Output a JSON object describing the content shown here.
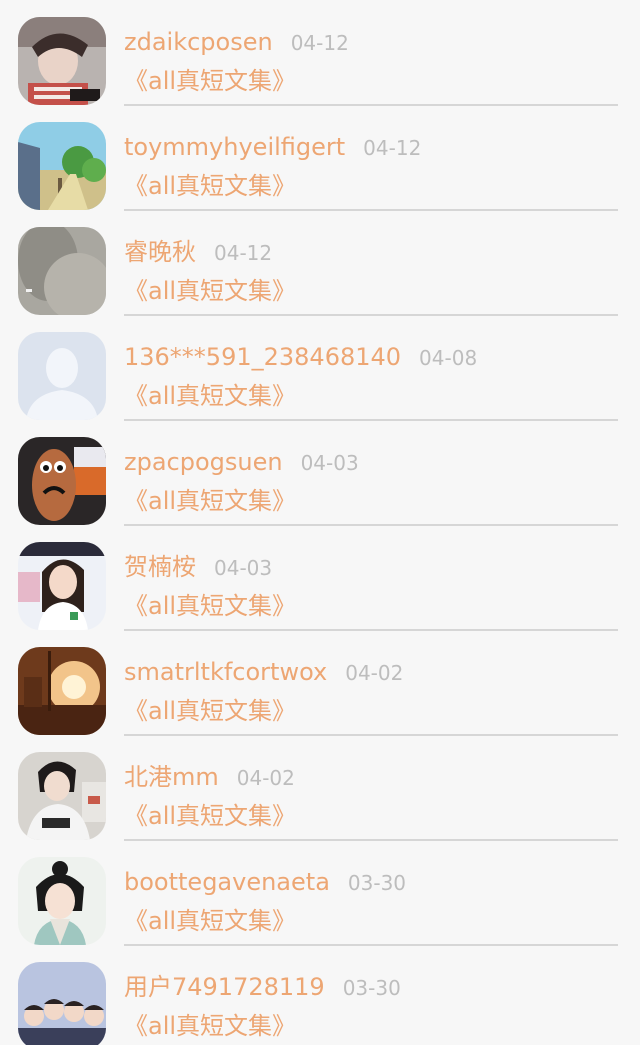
{
  "items": [
    {
      "user": "zdaikcposen",
      "date": "04-12",
      "work": "《all真短文集》"
    },
    {
      "user": "toymmyhyeilfigert",
      "date": "04-12",
      "work": "《all真短文集》"
    },
    {
      "user": "睿晚秋",
      "date": "04-12",
      "work": "《all真短文集》"
    },
    {
      "user": "136***591_238468140",
      "date": "04-08",
      "work": "《all真短文集》"
    },
    {
      "user": "zpacpogsuen",
      "date": "04-03",
      "work": "《all真短文集》"
    },
    {
      "user": "贺楠桉",
      "date": "04-03",
      "work": "《all真短文集》"
    },
    {
      "user": "smatrltkfcortwox",
      "date": "04-02",
      "work": "《all真短文集》"
    },
    {
      "user": "北港mm",
      "date": "04-02",
      "work": "《all真短文集》"
    },
    {
      "user": "boottegavenaeta",
      "date": "03-30",
      "work": "《all真短文集》"
    },
    {
      "user": "用户7491728119",
      "date": "03-30",
      "work": "《all真短文集》"
    }
  ],
  "colors": {
    "accent": "#eda673",
    "date": "#bdbdbd",
    "divider": "#d6d6d6",
    "background": "#f7f7f7"
  }
}
